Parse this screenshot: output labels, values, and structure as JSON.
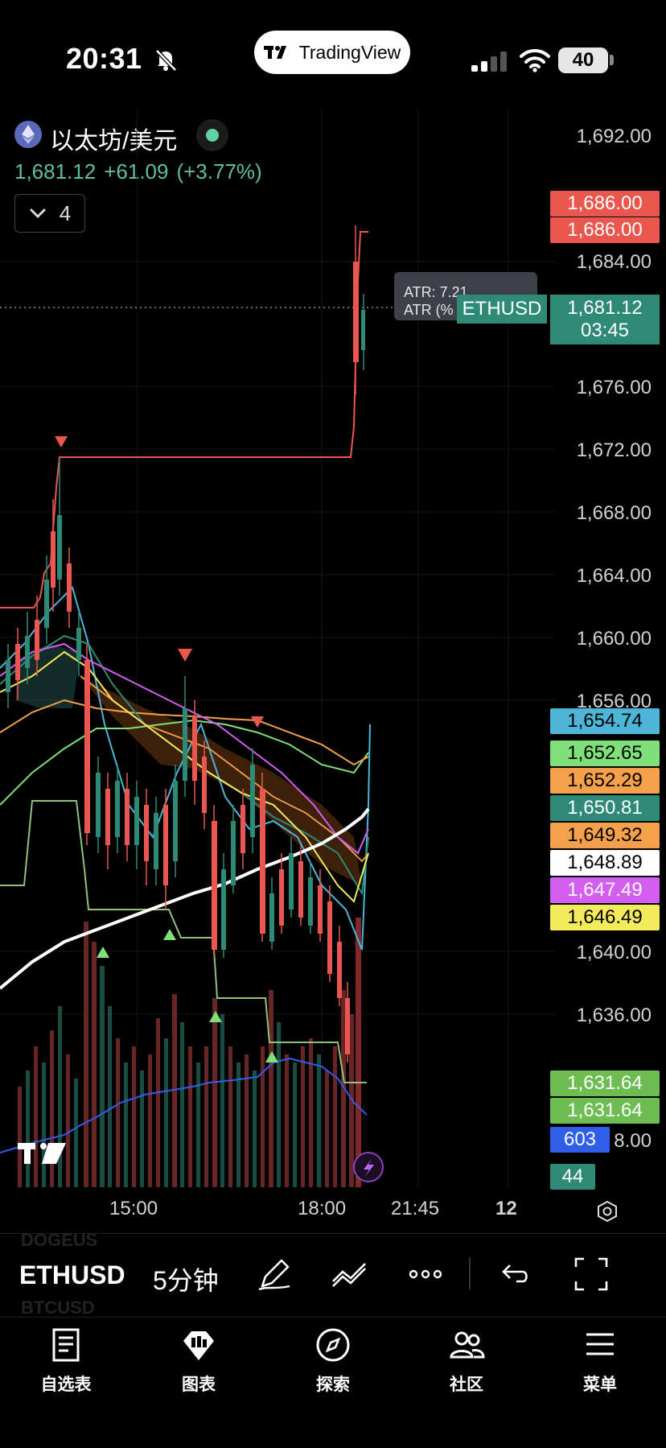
{
  "status_bar": {
    "time": "20:31",
    "battery": "40",
    "app_pill": "TradingView"
  },
  "header": {
    "symbol_title": "以太坊/美元",
    "last_price": "1,681.12",
    "change": "+61.09",
    "change_pct": "(+3.77%)",
    "collapse_count": "4"
  },
  "price_axis": {
    "ticks": [
      "1,692.00",
      "1,684.00",
      "1,676.00",
      "1,672.00",
      "1,668.00",
      "1,664.00",
      "1,660.00",
      "1,656.00",
      "1,640.00",
      "1,636.00",
      "8.00"
    ],
    "tags": [
      {
        "value": "1,686.00",
        "color": "#e9574f"
      },
      {
        "value": "1,686.00",
        "color": "#e9574f"
      },
      {
        "value": "1,654.74",
        "color": "#4db6d8"
      },
      {
        "value": "1,652.65",
        "color": "#7fe07a"
      },
      {
        "value": "1,652.29",
        "color": "#f5a04a"
      },
      {
        "value": "1,650.81",
        "color": "#2e8a76"
      },
      {
        "value": "1,649.32",
        "color": "#f5a04a"
      },
      {
        "value": "1,648.89",
        "color": "#ffffff"
      },
      {
        "value": "1,647.49",
        "color": "#d35ef0"
      },
      {
        "value": "1,646.49",
        "color": "#f3ea5c"
      },
      {
        "value": "1,631.64",
        "color": "#6dbd53"
      },
      {
        "value": "1,631.64",
        "color": "#6dbd53"
      },
      {
        "value": "603",
        "color": "#2f5fe8"
      },
      {
        "value": "44",
        "color": "#2e8a76"
      }
    ],
    "current_price": "1,681.12",
    "countdown": "03:45",
    "symbol_tag": "ETHUSD"
  },
  "atr_tooltip": {
    "line1": "ATR: 7.21",
    "line2": "ATR (%"
  },
  "time_axis": {
    "labels": [
      "15:00",
      "18:00",
      "21:45",
      "12"
    ]
  },
  "toolbar": {
    "symbol": "ETHUSD",
    "interval": "5分钟",
    "ghost_above": "DOGEUS",
    "ghost_below": "BTCUSD"
  },
  "nav": {
    "items": [
      {
        "label": "自选表",
        "icon": "watchlist-icon"
      },
      {
        "label": "图表",
        "icon": "chart-icon"
      },
      {
        "label": "探索",
        "icon": "compass-icon"
      },
      {
        "label": "社区",
        "icon": "community-icon"
      },
      {
        "label": "菜单",
        "icon": "menu-icon"
      }
    ]
  },
  "colors": {
    "up": "#2e8a76",
    "down": "#e9574f",
    "accent_green": "#5fbf9b"
  }
}
